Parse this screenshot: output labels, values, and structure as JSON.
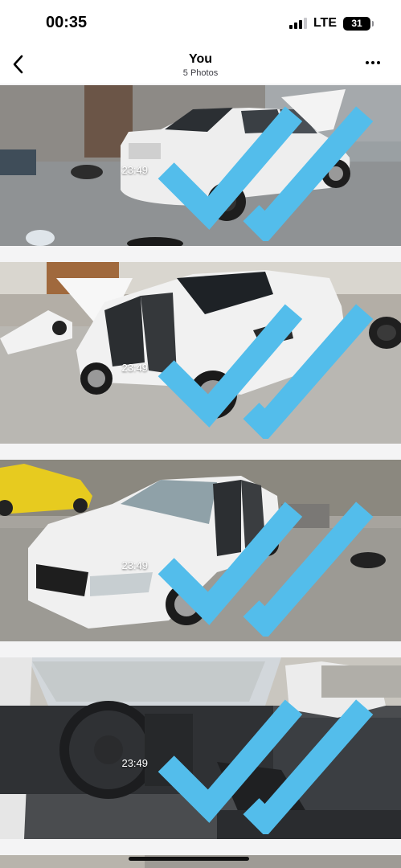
{
  "status_bar": {
    "time": "00:35",
    "network": "LTE",
    "battery_level": "31"
  },
  "nav": {
    "title": "You",
    "subtitle": "5 Photos"
  },
  "photos": [
    {
      "timestamp": "23:49",
      "read_tick_color": "#53bdeb"
    },
    {
      "timestamp": "23:49",
      "read_tick_color": "#53bdeb"
    },
    {
      "timestamp": "23:49",
      "read_tick_color": "#53bdeb"
    },
    {
      "timestamp": "23:49",
      "read_tick_color": "#53bdeb"
    }
  ],
  "colors": {
    "background": "#f4f4f5",
    "bar": "#ffffff",
    "text": "#000000"
  }
}
